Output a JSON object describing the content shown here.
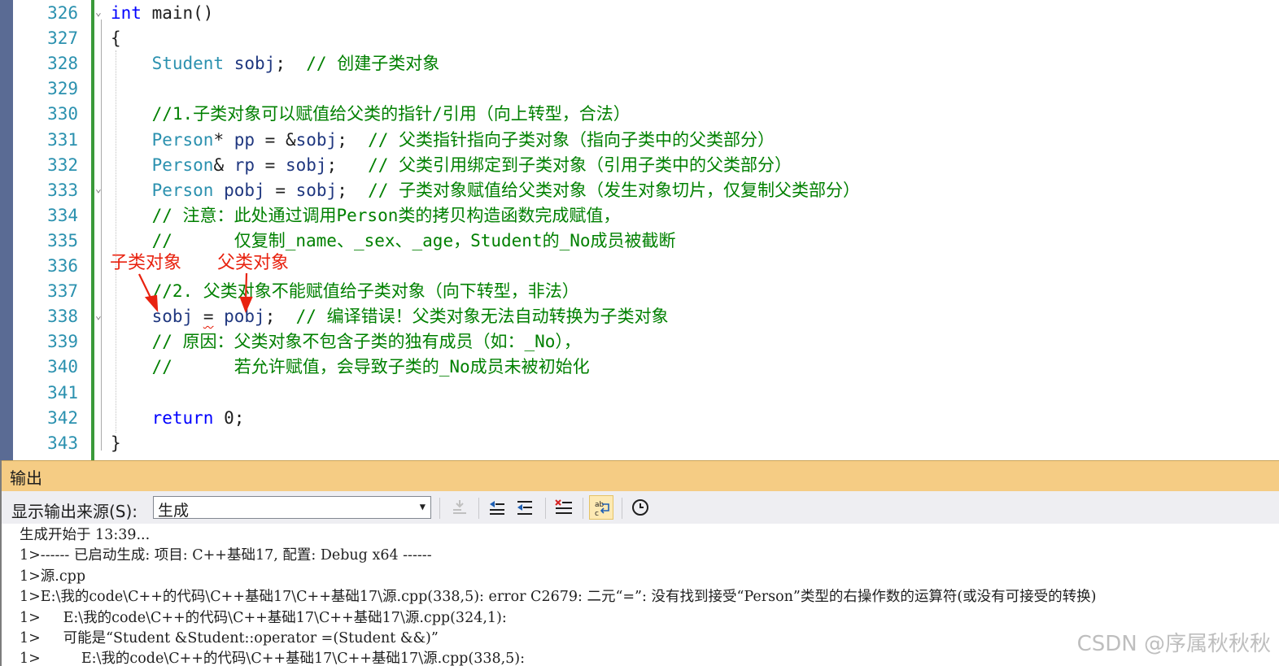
{
  "editor": {
    "line_numbers": [
      "326",
      "327",
      "328",
      "329",
      "330",
      "331",
      "332",
      "333",
      "334",
      "335",
      "336",
      "337",
      "338",
      "339",
      "340",
      "341",
      "342",
      "343"
    ],
    "lines": [
      {
        "segments": [
          {
            "t": "int",
            "c": "kw"
          },
          {
            "t": " main()",
            "c": "pl"
          }
        ]
      },
      {
        "segments": [
          {
            "t": "{",
            "c": "pl"
          }
        ]
      },
      {
        "segments": [
          {
            "t": "    ",
            "c": "pl"
          },
          {
            "t": "Student",
            "c": "ty"
          },
          {
            "t": " ",
            "c": "pl"
          },
          {
            "t": "sobj",
            "c": "id"
          },
          {
            "t": ";  ",
            "c": "pl"
          },
          {
            "t": "// 创建子类对象",
            "c": "cm"
          }
        ]
      },
      {
        "segments": []
      },
      {
        "segments": [
          {
            "t": "    ",
            "c": "pl"
          },
          {
            "t": "//1.子类对象可以赋值给父类的指针/引用（向上转型，合法）",
            "c": "cm"
          }
        ]
      },
      {
        "segments": [
          {
            "t": "    ",
            "c": "pl"
          },
          {
            "t": "Person",
            "c": "ty"
          },
          {
            "t": "* ",
            "c": "pl"
          },
          {
            "t": "pp",
            "c": "id"
          },
          {
            "t": " = &",
            "c": "pl"
          },
          {
            "t": "sobj",
            "c": "id"
          },
          {
            "t": ";  ",
            "c": "pl"
          },
          {
            "t": "// 父类指针指向子类对象（指向子类中的父类部分）",
            "c": "cm"
          }
        ]
      },
      {
        "segments": [
          {
            "t": "    ",
            "c": "pl"
          },
          {
            "t": "Person",
            "c": "ty"
          },
          {
            "t": "& ",
            "c": "pl"
          },
          {
            "t": "rp",
            "c": "id"
          },
          {
            "t": " = ",
            "c": "pl"
          },
          {
            "t": "sobj",
            "c": "id"
          },
          {
            "t": ";   ",
            "c": "pl"
          },
          {
            "t": "// 父类引用绑定到子类对象（引用子类中的父类部分）",
            "c": "cm"
          }
        ]
      },
      {
        "segments": [
          {
            "t": "    ",
            "c": "pl"
          },
          {
            "t": "Person",
            "c": "ty"
          },
          {
            "t": " ",
            "c": "pl"
          },
          {
            "t": "pobj",
            "c": "id"
          },
          {
            "t": " = ",
            "c": "pl"
          },
          {
            "t": "sobj",
            "c": "id"
          },
          {
            "t": ";  ",
            "c": "pl"
          },
          {
            "t": "// 子类对象赋值给父类对象（发生对象切片，仅复制父类部分）",
            "c": "cm"
          }
        ]
      },
      {
        "segments": [
          {
            "t": "    ",
            "c": "pl"
          },
          {
            "t": "// 注意：此处通过调用Person类的拷贝构造函数完成赋值，",
            "c": "cm"
          }
        ]
      },
      {
        "segments": [
          {
            "t": "    ",
            "c": "pl"
          },
          {
            "t": "//      仅复制_name、_sex、_age，Student的_No成员被截断",
            "c": "cm"
          }
        ]
      },
      {
        "segments": []
      },
      {
        "segments": [
          {
            "t": "    ",
            "c": "pl"
          },
          {
            "t": "//2. 父类对象不能赋值给子类对象（向下转型，非法）",
            "c": "cm"
          }
        ]
      },
      {
        "segments": [
          {
            "t": "    ",
            "c": "pl"
          },
          {
            "t": "sobj",
            "c": "id"
          },
          {
            "t": " ",
            "c": "pl"
          },
          {
            "t": "=",
            "c": "pl squig"
          },
          {
            "t": " ",
            "c": "pl"
          },
          {
            "t": "pobj",
            "c": "id"
          },
          {
            "t": ";  ",
            "c": "pl"
          },
          {
            "t": "// 编译错误！父类对象无法自动转换为子类对象",
            "c": "cm"
          }
        ]
      },
      {
        "segments": [
          {
            "t": "    ",
            "c": "pl"
          },
          {
            "t": "// 原因：父类对象不包含子类的独有成员（如：_No），",
            "c": "cm"
          }
        ]
      },
      {
        "segments": [
          {
            "t": "    ",
            "c": "pl"
          },
          {
            "t": "//      若允许赋值，会导致子类的_No成员未被初始化",
            "c": "cm"
          }
        ]
      },
      {
        "segments": []
      },
      {
        "segments": [
          {
            "t": "    ",
            "c": "pl"
          },
          {
            "t": "return",
            "c": "kw"
          },
          {
            "t": " 0;",
            "c": "pl"
          }
        ]
      },
      {
        "segments": [
          {
            "t": "}",
            "c": "pl"
          }
        ]
      }
    ]
  },
  "annotations": {
    "label_child": "子类对象",
    "label_parent": "父类对象",
    "color": "#e8220f"
  },
  "output": {
    "title": "输出",
    "source_label": "显示输出来源(S):",
    "source_value": "生成",
    "lines": [
      "生成开始于 13:39...",
      "1>------ 已启动生成: 项目: C++基础17, 配置: Debug x64 ------",
      "1>源.cpp",
      "1>E:\\我的code\\C++的代码\\C++基础17\\C++基础17\\源.cpp(338,5): error C2679: 二元“=”: 没有找到接受“Person”类型的右操作数的运算符(或没有可接受的转换)",
      "1>     E:\\我的code\\C++的代码\\C++基础17\\C++基础17\\源.cpp(324,1):",
      "1>     可能是“Student &Student::operator =(Student &&)”",
      "1>         E:\\我的code\\C++的代码\\C++基础17\\C++基础17\\源.cpp(338,5):"
    ]
  },
  "watermark": "CSDN @序属秋秋秋",
  "toolbar_icons": [
    "goto-previous-message-icon",
    "previous-icon",
    "next-icon",
    "clear-all-icon",
    "word-wrap-icon",
    "timestamp-clock-icon"
  ]
}
